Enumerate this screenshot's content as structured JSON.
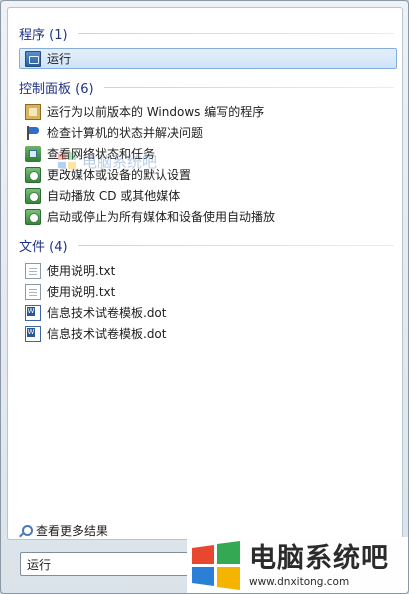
{
  "groups": [
    {
      "title": "程序 (1)",
      "items": [
        {
          "label": "运行",
          "icon": "run-icon",
          "selected": true
        }
      ]
    },
    {
      "title": "控制面板 (6)",
      "items": [
        {
          "label": "运行为以前版本的 Windows 编写的程序",
          "icon": "compatibility-icon"
        },
        {
          "label": "检查计算机的状态并解决问题",
          "icon": "action-center-flag-icon"
        },
        {
          "label": "查看网络状态和任务",
          "icon": "network-icon"
        },
        {
          "label": "更改媒体或设备的默认设置",
          "icon": "autoplay-icon"
        },
        {
          "label": "自动播放 CD 或其他媒体",
          "icon": "autoplay-icon"
        },
        {
          "label": "启动或停止为所有媒体和设备使用自动播放",
          "icon": "autoplay-icon"
        }
      ]
    },
    {
      "title": "文件 (4)",
      "items": [
        {
          "label": "使用说明.txt",
          "icon": "text-file-icon"
        },
        {
          "label": "使用说明.txt",
          "icon": "text-file-icon"
        },
        {
          "label": "信息技术试卷模板.dot",
          "icon": "word-template-icon"
        },
        {
          "label": "信息技术试卷模板.dot",
          "icon": "word-template-icon"
        }
      ]
    }
  ],
  "see_more_label": "查看更多结果",
  "search_value": "运行",
  "watermark_mid_text": "电脑系统吧",
  "brand": {
    "name": "电脑系统吧",
    "url": "www.dnxitong.com"
  },
  "colors": {
    "group_title": "#1e3287",
    "selection_fill": "#cfe3f7",
    "selection_border": "#84acdd",
    "logo_red": "#e8462f",
    "logo_green": "#34a853",
    "logo_blue": "#2a7fd6",
    "logo_yellow": "#f4b400"
  }
}
